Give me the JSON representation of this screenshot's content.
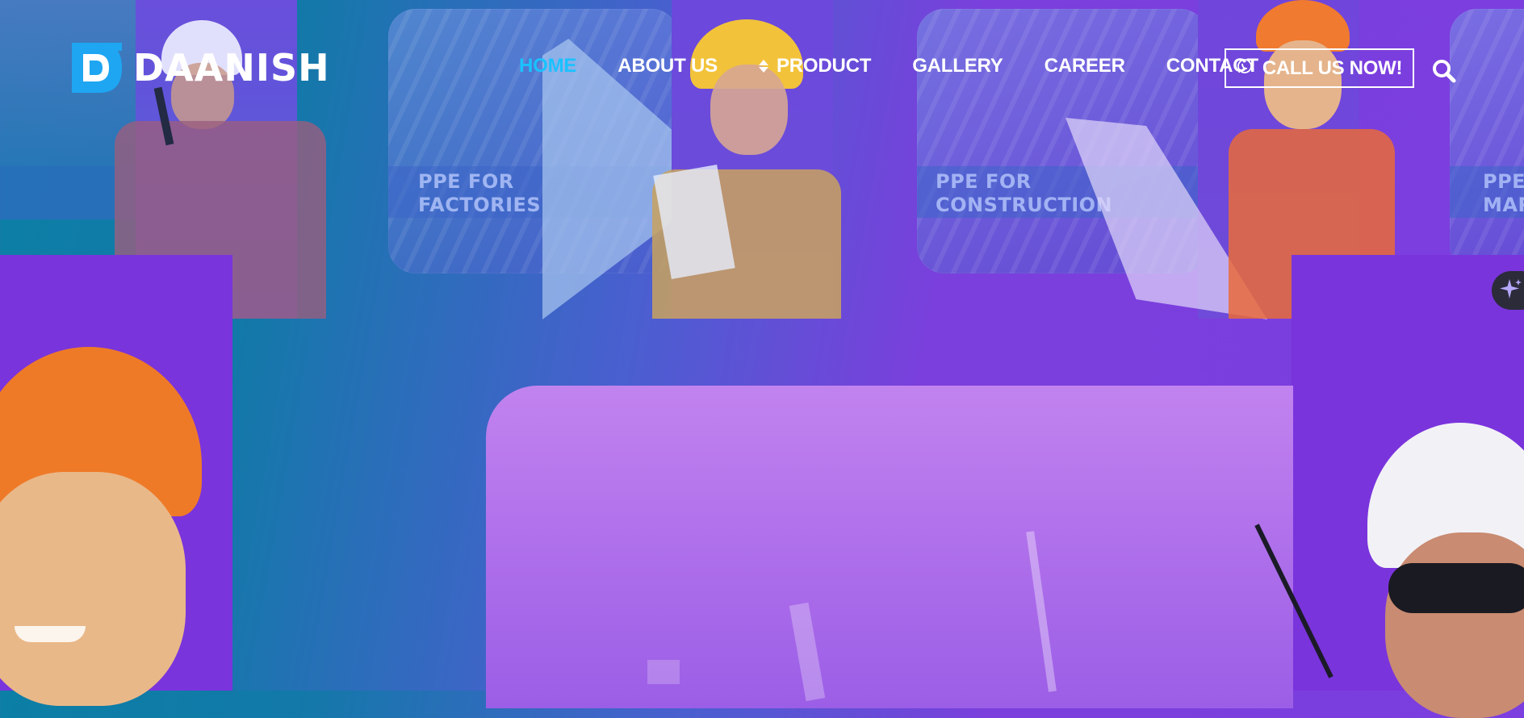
{
  "brand": {
    "name": "DAANISH",
    "logo_icon": "daanish-d-logo-icon"
  },
  "nav": {
    "items": [
      {
        "label": "HOME",
        "active": true
      },
      {
        "label": "ABOUT US",
        "active": false
      },
      {
        "label": "PRODUCT",
        "active": false,
        "icon": "sort-arrows-icon"
      },
      {
        "label": "GALLERY",
        "active": false
      },
      {
        "label": "CAREER",
        "active": false
      },
      {
        "label": "CONTACT",
        "active": false
      }
    ],
    "cta": {
      "label": "CALL US NOW!",
      "icon": "whatsapp-icon"
    },
    "search_icon": "search-icon"
  },
  "hero": {
    "tiles": [
      {
        "line1": "PPE FOR",
        "line2": "FACTORIES"
      },
      {
        "line1": "PPE FOR",
        "line2": "CONSTRUCTION"
      },
      {
        "line1": "PPE F",
        "line2": "MAR"
      }
    ]
  },
  "floating": {
    "ai_icon": "sparkle-icon"
  },
  "colors": {
    "accent_active": "#19c2ff",
    "logo_blue": "#1ea6f2",
    "panel_violet": "#7a34dc",
    "teal": "#0c7fa6"
  }
}
